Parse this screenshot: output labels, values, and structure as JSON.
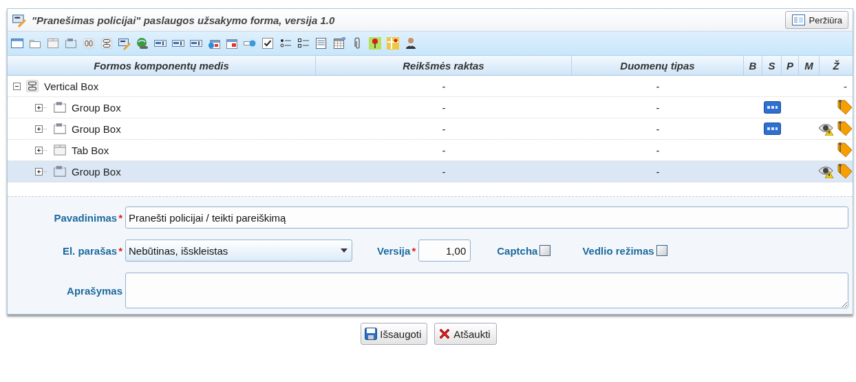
{
  "panel": {
    "title": "\"Pranešimas policijai\" paslaugos užsakymo forma, versija 1.0",
    "preview_button": "Peržiūra"
  },
  "tree_table": {
    "columns": [
      "Formos komponentų medis",
      "Reikšmės raktas",
      "Duomenų tipas",
      "B",
      "S",
      "P",
      "M",
      "Ž"
    ],
    "rows": [
      {
        "label": "Vertical Box",
        "kind": "vbox",
        "expanded": true,
        "selected": false,
        "value_key": "-",
        "data_type": "-",
        "css": false,
        "visibility_warning": false,
        "info_tag": false,
        "z": "-",
        "children": [
          {
            "label": "Group Box",
            "kind": "groupbox",
            "expanded": false,
            "selected": false,
            "value_key": "-",
            "data_type": "-",
            "css": true,
            "visibility_warning": false,
            "info_tag": true
          },
          {
            "label": "Group Box",
            "kind": "groupbox",
            "expanded": false,
            "selected": false,
            "value_key": "-",
            "data_type": "-",
            "css": true,
            "visibility_warning": true,
            "info_tag": true
          },
          {
            "label": "Tab Box",
            "kind": "tabbox",
            "expanded": false,
            "selected": false,
            "value_key": "-",
            "data_type": "-",
            "css": false,
            "visibility_warning": false,
            "info_tag": true
          },
          {
            "label": "Group Box",
            "kind": "groupbox",
            "expanded": false,
            "selected": true,
            "value_key": "-",
            "data_type": "-",
            "css": false,
            "visibility_warning": true,
            "info_tag": true
          }
        ]
      }
    ]
  },
  "form": {
    "name": {
      "label": "Pavadinimas",
      "required_mark": "*",
      "value": "Pranešti policijai / teikti pareiškimą"
    },
    "signature": {
      "label": "El. parašas",
      "required_mark": "*",
      "value": "Nebūtinas, išskleistas"
    },
    "version": {
      "label": "Versija",
      "required_mark": "*",
      "value": "1,00"
    },
    "captcha": {
      "label": "Captcha",
      "checked": false
    },
    "wizard_mode": {
      "label": "Vedlio režimas",
      "checked": false
    },
    "description": {
      "label": "Aprašymas"
    }
  },
  "buttons": [
    {
      "label": "Išsaugoti",
      "kind": "save"
    },
    {
      "label": "Atšaukti",
      "kind": "cancel"
    }
  ]
}
